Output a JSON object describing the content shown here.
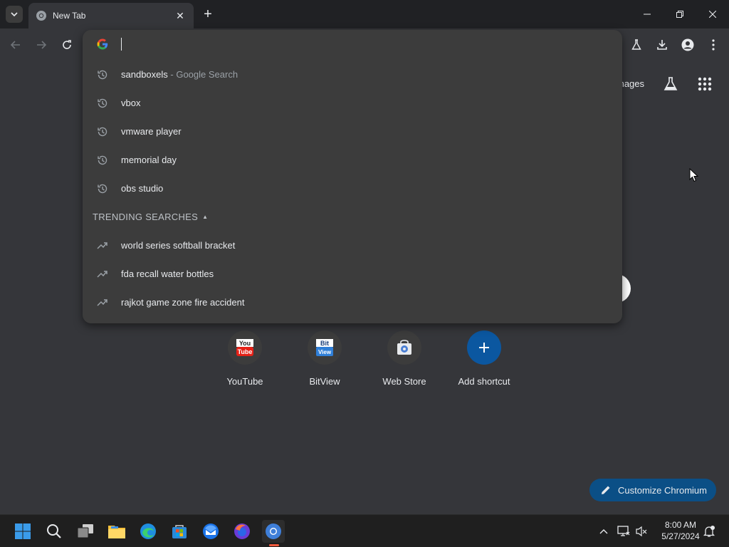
{
  "browser": {
    "tab": {
      "title": "New Tab"
    },
    "window_controls": [
      "minimize",
      "restore",
      "close"
    ]
  },
  "omnibox": {
    "input_value": "",
    "history": [
      {
        "query": "sandboxels",
        "suffix": " - Google Search",
        "icon": "history-icon"
      },
      {
        "query": "vbox",
        "suffix": "",
        "icon": "history-icon"
      },
      {
        "query": "vmware player",
        "suffix": "",
        "icon": "history-icon"
      },
      {
        "query": "memorial day",
        "suffix": "",
        "icon": "history-icon"
      },
      {
        "query": "obs studio",
        "suffix": "",
        "icon": "history-icon"
      }
    ],
    "trending_header": "TRENDING SEARCHES",
    "trending": [
      {
        "query": "world series softball bracket",
        "icon": "trending-icon"
      },
      {
        "query": "fda recall water bottles",
        "icon": "trending-icon"
      },
      {
        "query": "rajkot game zone fire accident",
        "icon": "trending-icon"
      }
    ]
  },
  "ntp": {
    "images_link": "mages",
    "shortcuts": [
      {
        "label": "YouTube",
        "icon": "youtube-icon"
      },
      {
        "label": "BitView",
        "icon": "bitview-icon"
      },
      {
        "label": "Web Store",
        "icon": "webstore-icon"
      },
      {
        "label": "Add shortcut",
        "icon": "plus-icon"
      }
    ],
    "customize_label": "Customize Chromium"
  },
  "taskbar": {
    "time": "8:00 AM",
    "date": "5/27/2024"
  },
  "colors": {
    "accent": "#0b57a0",
    "customize_bg": "#0b4f86",
    "active_indicator": "#f25a3d"
  }
}
